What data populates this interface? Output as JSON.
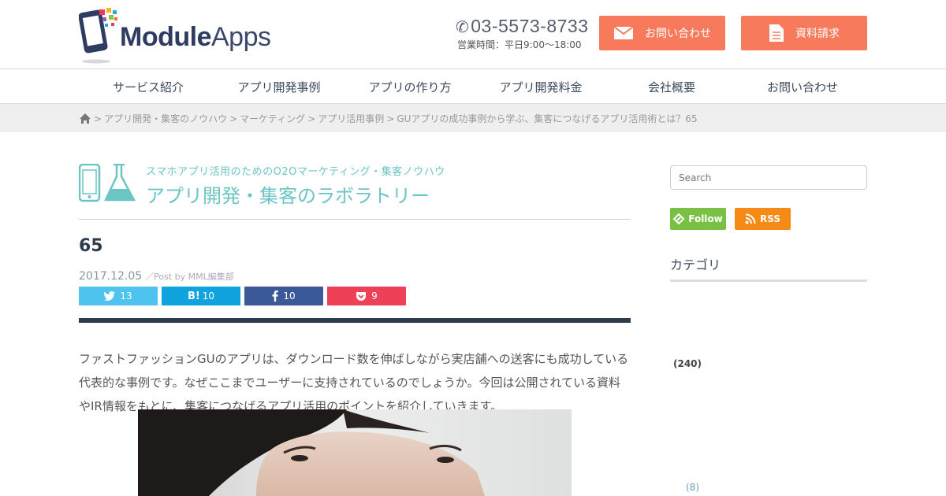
{
  "header": {
    "logo_bold": "Module",
    "logo_light": "Apps",
    "phone": "03-5573-8733",
    "hours": "営業時間：平日9:00〜18:00",
    "contact_label": "お問い合わせ",
    "docs_label": "資料請求",
    "accent_color": "#f87a5c"
  },
  "nav": {
    "items": [
      "サービス紹介",
      "アプリ開発事例",
      "アプリの作り方",
      "アプリ開発料金",
      "会社概要",
      "お問い合わせ"
    ]
  },
  "breadcrumb": {
    "items": [
      "アプリ開発・集客のノウハウ",
      "マーケティング",
      "アプリ活用事例",
      "GUアプリの成功事例から学ぶ、集客につなげるアプリ活用術とは？65"
    ]
  },
  "category": {
    "subtitle": "スマホアプリ活用のためのO2Oマーケティング・集客ノウハウ",
    "title": "アプリ開発・集客のラボラトリー",
    "color": "#6cc5c5"
  },
  "post": {
    "title": "65",
    "date": "2017.12.05",
    "author": "／Post by MML編集部",
    "body": "ファストファッションGUのアプリは、ダウンロード数を伸ばしながら実店舗への送客にも成功している代表的な事例です。なぜここまでユーザーに支持されているのでしょうか。今回は公開されている資料やIR情報をもとに、集客につなげるアプリ活用のポイントを紹介していきます。"
  },
  "share": {
    "twitter": "13",
    "hatena_icon": "B!",
    "hatena": "10",
    "facebook": "10",
    "pocket": "9"
  },
  "sidebar": {
    "search_placeholder": "Search",
    "follow_label": "Follow",
    "rss_label": "RSS",
    "heading": "カテゴリ",
    "count_1": "(240)",
    "count_2": "(8)"
  }
}
